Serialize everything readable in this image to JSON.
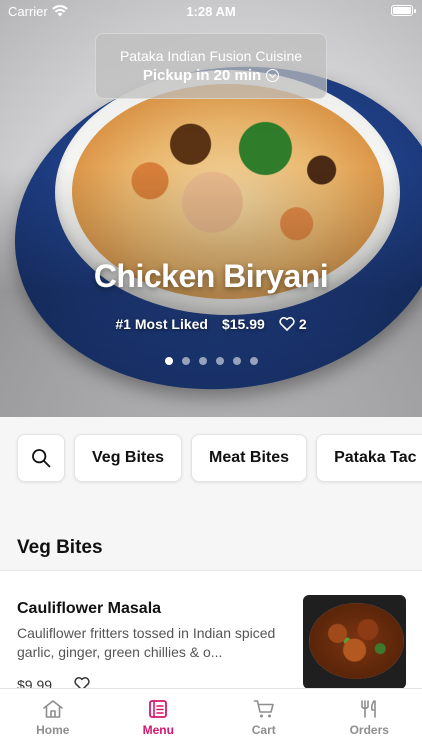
{
  "status_bar": {
    "carrier": "Carrier",
    "time": "1:28 AM",
    "icons": [
      "wifi-icon",
      "battery-icon"
    ]
  },
  "pickup": {
    "restaurant_name": "Pataka Indian Fusion Cuisine",
    "pickup_label": "Pickup in 20 min",
    "icon": "chevron-circle-down-icon"
  },
  "hero": {
    "title": "Chicken Biryani",
    "rank_label": "#1 Most Liked",
    "price": "$15.99",
    "likes": "2",
    "carousel_pages": 6,
    "carousel_active_index": 0
  },
  "categories": {
    "search_icon": "search-icon",
    "items": [
      "Veg Bites",
      "Meat Bites",
      "Pataka Tac"
    ]
  },
  "section": {
    "title": "Veg Bites"
  },
  "menu_items": [
    {
      "name": "Cauliflower Masala",
      "description": "Cauliflower fritters tossed in Indian spiced garlic, ginger, green chillies & o...",
      "price": "$9.99"
    }
  ],
  "tab_bar": {
    "tabs": [
      {
        "label": "Home",
        "icon": "home-icon"
      },
      {
        "label": "Menu",
        "icon": "menu-icon"
      },
      {
        "label": "Cart",
        "icon": "cart-icon"
      },
      {
        "label": "Orders",
        "icon": "orders-icon"
      }
    ],
    "active_tab": "Menu"
  },
  "colors": {
    "accent": "#d6176d",
    "inactive_tab": "#8e8e8e",
    "background_strip": "#f6f6f6"
  }
}
